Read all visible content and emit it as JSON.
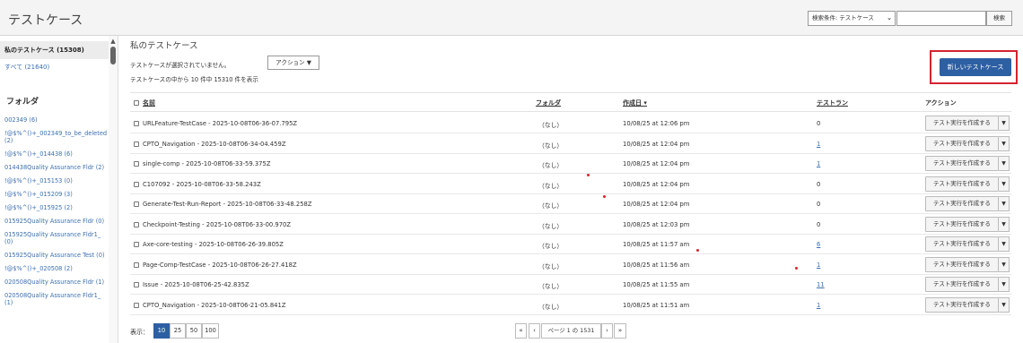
{
  "header": {
    "title": "テストケース",
    "search_condition": "検索条件: テストケース",
    "search_input_value": "",
    "search_button": "検索"
  },
  "sidebar": {
    "selected": "私のテストケース (15308)",
    "all": "すべて (21640)",
    "folder_heading": "フォルダ",
    "folders": [
      "002349 (6)",
      "!@$%^()+_002349_to_be_deleted (2)",
      "!@$%^()+_014438 (6)",
      "014438Quality Assurance Fldr (2)",
      "!@$%^()+_015153 (0)",
      "!@$%^()+_015209 (3)",
      "!@$%^()+_015925 (2)",
      "015925Quality Assurance Fldr (0)",
      "015925Quality Assurance Fldr1_ (0)",
      "015925Quality Assurance Test (0)",
      "!@$%^()+_020508 (2)",
      "020508Quality Assurance Fldr (1)",
      "020508Quality Assurance Fldr1_ (1)"
    ]
  },
  "main": {
    "title": "私のテストケース",
    "no_selection": "テストケースが選択されていません。",
    "action_button": "アクション ▼",
    "showing": "テストケースの中から 10 件中 15310 件を表示",
    "new_button": "新しいテストケース"
  },
  "table": {
    "headers": {
      "name": "名前",
      "folder": "フォルダ",
      "created": "作成日 ▾",
      "testruns": "テストラン",
      "action": "アクション"
    },
    "rows": [
      {
        "name": "URLFeature-TestCase - 2025-10-08T06-36-07.795Z",
        "folder": "（なし）",
        "created": "10/08/25 at 12:06 pm",
        "runs": "0",
        "run_button": "テスト実行を作成する"
      },
      {
        "name": "CPTO_Navigation - 2025-10-08T06-34-04.459Z",
        "folder": "（なし）",
        "created": "10/08/25 at 12:04 pm",
        "runs": "1",
        "run_button": "テスト実行を作成する"
      },
      {
        "name": "single-comp - 2025-10-08T06-33-59.375Z",
        "folder": "（なし）",
        "created": "10/08/25 at 12:04 pm",
        "runs": "1",
        "run_button": "テスト実行を作成する"
      },
      {
        "name": "C107092 - 2025-10-08T06-33-58.243Z",
        "folder": "（なし）",
        "created": "10/08/25 at 12:04 pm",
        "runs": "0",
        "run_button": "テスト実行を作成する"
      },
      {
        "name": "Generate-Test-Run-Report - 2025-10-08T06-33-48.258Z",
        "folder": "（なし）",
        "created": "10/08/25 at 12:04 pm",
        "runs": "0",
        "run_button": "テスト実行を作成する"
      },
      {
        "name": "Checkpoint-Testing - 2025-10-08T06-33-00.970Z",
        "folder": "（なし）",
        "created": "10/08/25 at 12:03 pm",
        "runs": "0",
        "run_button": "テスト実行を作成する"
      },
      {
        "name": "Axe-core-testing - 2025-10-08T06-26-39.805Z",
        "folder": "（なし）",
        "created": "10/08/25 at 11:57 am",
        "runs": "6",
        "run_button": "テスト実行を作成する"
      },
      {
        "name": "Page-Comp-TestCase - 2025-10-08T06-26-27.418Z",
        "folder": "（なし）",
        "created": "10/08/25 at 11:56 am",
        "runs": "1",
        "run_button": "テスト実行を作成する"
      },
      {
        "name": "Issue - 2025-10-08T06-25-42.835Z",
        "folder": "（なし）",
        "created": "10/08/25 at 11:55 am",
        "runs": "11",
        "run_button": "テスト実行を作成する"
      },
      {
        "name": "CPTO_Navigation - 2025-10-08T06-21-05.841Z",
        "folder": "（なし）",
        "created": "10/08/25 at 11:51 am",
        "runs": "1",
        "run_button": "テスト実行を作成する"
      }
    ]
  },
  "footer": {
    "show_label": "表示：",
    "page_sizes": [
      "10",
      "25",
      "50",
      "100"
    ],
    "active_page_size": "10",
    "first": "«",
    "prev": "‹",
    "page_text": "ページ 1 の 1531",
    "next": "›",
    "last": "»"
  },
  "colors": {
    "accent": "#2d5fa3",
    "link": "#3b6fb0",
    "highlight": "#d4242f"
  }
}
